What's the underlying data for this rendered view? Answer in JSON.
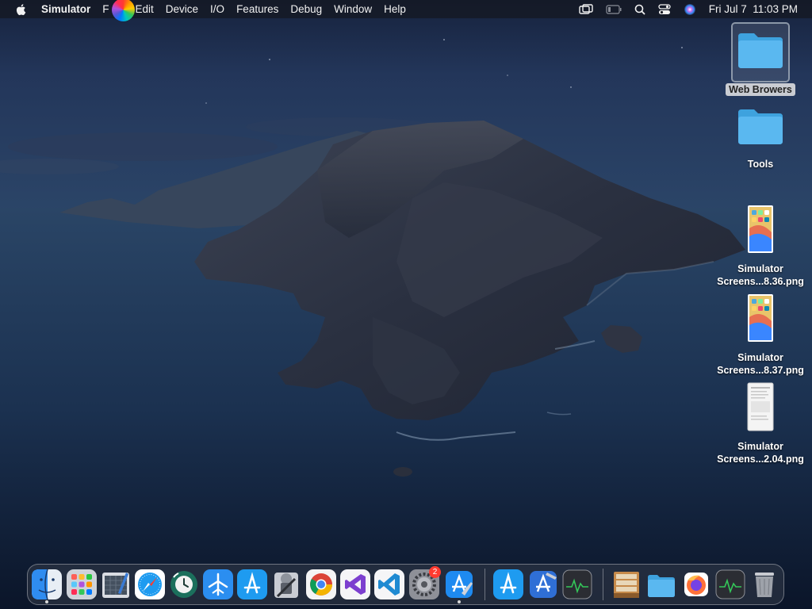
{
  "menubar": {
    "app_name": "Simulator",
    "menus": [
      "F",
      "Edit",
      "Device",
      "I/O",
      "Features",
      "Debug",
      "Window",
      "Help"
    ],
    "clock": "Fri Jul 7  11:03 PM",
    "status_icons": [
      "screen-mirroring-icon",
      "battery-icon",
      "spotlight-search-icon",
      "control-center-icon",
      "siri-icon"
    ]
  },
  "desktop": {
    "icons": [
      {
        "label": "Web Browers",
        "type": "folder",
        "selected": true
      },
      {
        "label": "Tools",
        "type": "folder",
        "selected": false
      },
      {
        "label_line1": "Simulator",
        "label_line2": "Screens...8.36.png",
        "type": "phone-screenshot"
      },
      {
        "label_line1": "Simulator",
        "label_line2": "Screens...8.37.png",
        "type": "phone-screenshot"
      },
      {
        "label_line1": "Simulator",
        "label_line2": "Screens...2.04.png",
        "type": "document-screenshot"
      }
    ]
  },
  "dock": {
    "apps": [
      "finder-icon",
      "launchpad-icon",
      "screenshot-editor-icon",
      "safari-icon",
      "time-machine-icon",
      "testflight-icon",
      "app-store-connect-icon",
      "automator-icon",
      "chrome-icon",
      "visual-studio-icon",
      "vscode-icon",
      "system-preferences-icon",
      "xcode-icon",
      "app-store-icon",
      "instruments-icon",
      "activity-monitor-icon",
      "archive-utility-icon",
      "downloads-folder-icon",
      "firefox-icon",
      "activity-monitor-2-icon",
      "trash-icon"
    ],
    "system_preferences_badge": "2"
  },
  "colors": {
    "menubar_bg": "#141822",
    "folder_blue": "#5ab8f0",
    "badge_red": "#ff3b30"
  }
}
